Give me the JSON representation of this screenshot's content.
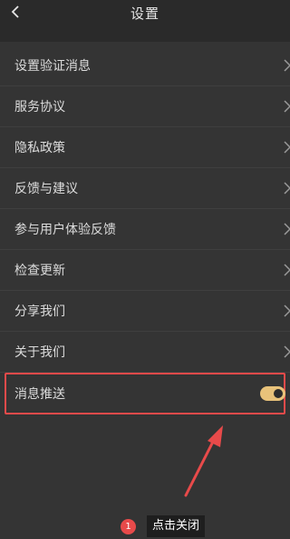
{
  "header": {
    "title": "设置",
    "back_icon": "chevron-left-icon"
  },
  "settings": {
    "items": [
      {
        "label": "设置验证消息"
      },
      {
        "label": "服务协议"
      },
      {
        "label": "隐私政策"
      },
      {
        "label": "反馈与建议"
      },
      {
        "label": "参与用户体验反馈"
      },
      {
        "label": "检查更新"
      },
      {
        "label": "分享我们"
      },
      {
        "label": "关于我们"
      }
    ],
    "push": {
      "label": "消息推送",
      "toggle_on": true
    }
  },
  "annotation": {
    "step_number": "1",
    "step_text": "点击关闭",
    "highlight_color": "#e84a4a"
  },
  "colors": {
    "background": "#343434",
    "header": "#2a2a2a",
    "text": "#dcdcdc",
    "toggle_accent": "#e8c27a"
  }
}
